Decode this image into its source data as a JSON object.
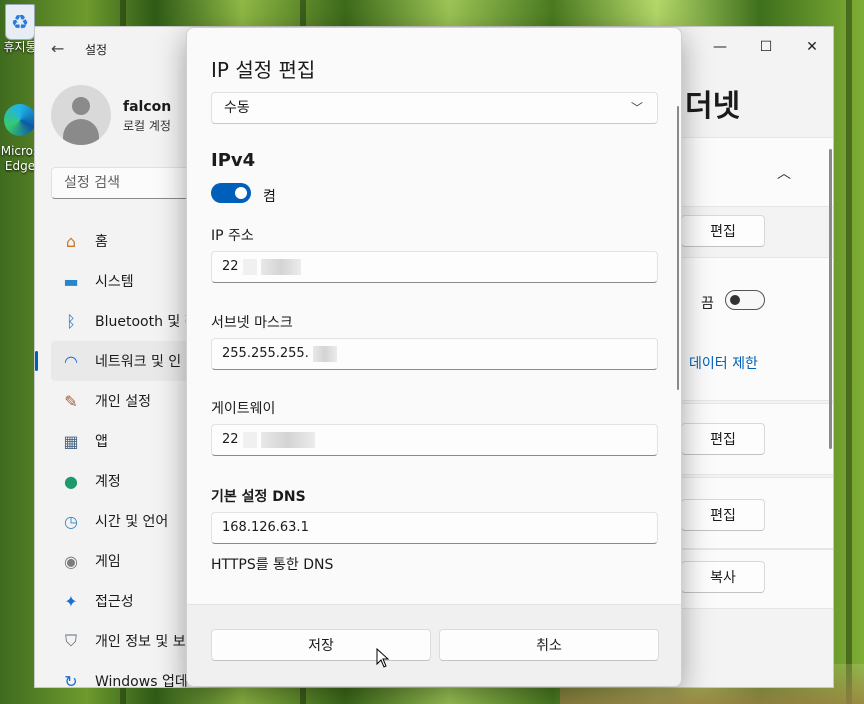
{
  "desktop": {
    "icons": [
      {
        "label": "휴지통"
      },
      {
        "label": "Micros Edge"
      }
    ]
  },
  "settings": {
    "app_title": "설정",
    "user": {
      "name": "falcon",
      "account_type": "로컬 계정"
    },
    "search_placeholder": "설정 검색",
    "nav": [
      {
        "label": "홈",
        "icon": "home-icon"
      },
      {
        "label": "시스템",
        "icon": "system-icon"
      },
      {
        "label": "Bluetooth 및 장",
        "icon": "bluetooth-icon"
      },
      {
        "label": "네트워크 및 인",
        "icon": "network-icon",
        "active": true
      },
      {
        "label": "개인 설정",
        "icon": "brush-icon"
      },
      {
        "label": "앱",
        "icon": "apps-icon"
      },
      {
        "label": "계정",
        "icon": "account-icon"
      },
      {
        "label": "시간 및 언어",
        "icon": "time-language-icon"
      },
      {
        "label": "게임",
        "icon": "gamepad-icon"
      },
      {
        "label": "접근성",
        "icon": "accessibility-icon"
      },
      {
        "label": "개인 정보 및 보",
        "icon": "shield-icon"
      },
      {
        "label": "Windows 업데",
        "icon": "update-icon"
      }
    ],
    "right": {
      "page_title": "더넷",
      "edit_1": "편집",
      "metered_state": "끔",
      "data_limit_link": "데이터 제한",
      "edit_2": "편집",
      "edit_3": "편집",
      "copy": "복사"
    }
  },
  "dialog": {
    "title": "IP 설정 편집",
    "mode": "수동",
    "section": "IPv4",
    "toggle_label": "켬",
    "ip_label": "IP 주소",
    "ip_value": "22",
    "mask_label": "서브넷 마스크",
    "mask_value": "255.255.255.",
    "gateway_label": "게이트웨이",
    "gateway_value": "22",
    "dns_label": "기본 설정 DNS",
    "dns_value": "168.126.63.1",
    "https_label": "HTTPS를 통한 DNS",
    "save": "저장",
    "cancel": "취소"
  },
  "colors": {
    "accent": "#005fb8"
  }
}
